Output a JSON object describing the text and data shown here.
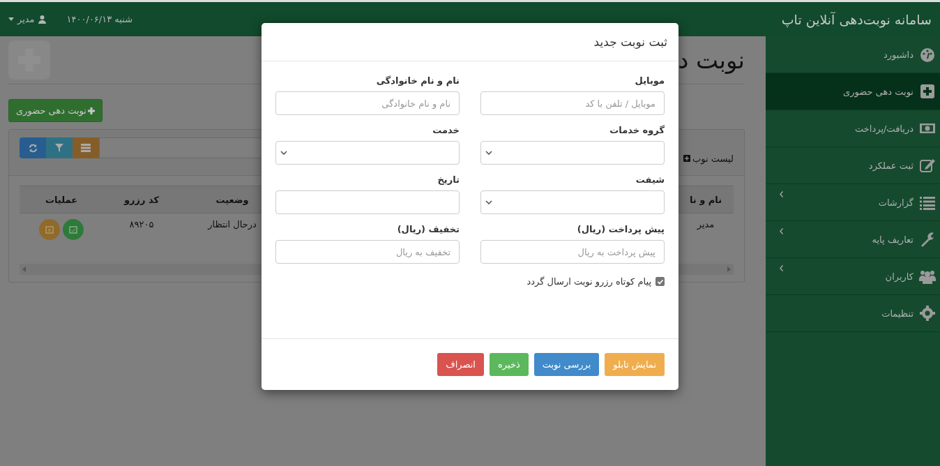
{
  "topbar": {
    "user": "مدیر",
    "date": "شنبه ۱۴۰۰/۰۶/۱۳"
  },
  "page": {
    "heading": "نوبت د",
    "add_button": "نوبت دهی حضوری"
  },
  "list_panel": {
    "title": "لیست نوب",
    "columns": [
      "نام و نا",
      "وضعیت",
      "کد رزرو",
      "عملیات"
    ],
    "rows": [
      {
        "code": "۸۹۲۰۵",
        "status": "درحال انتظار",
        "name": "مدیر"
      }
    ]
  },
  "sidebar": {
    "brand": "سامانه نوبت‌دهی آنلاین تاپ",
    "items": [
      {
        "label": "داشبورد",
        "selected": false,
        "expandable": false
      },
      {
        "label": "نوبت دهی حضوری",
        "selected": true,
        "expandable": false
      },
      {
        "label": "دریافت/پرداخت",
        "selected": false,
        "expandable": false
      },
      {
        "label": "ثبت عملکرد",
        "selected": false,
        "expandable": false
      },
      {
        "label": "گزارشات",
        "selected": false,
        "expandable": true
      },
      {
        "label": "تعاریف پایه",
        "selected": false,
        "expandable": true
      },
      {
        "label": "کاربران",
        "selected": false,
        "expandable": true
      },
      {
        "label": "تنظیمات",
        "selected": false,
        "expandable": false
      }
    ]
  },
  "modal": {
    "title": "ثبت نوبت جدید",
    "fields": [
      {
        "label": "موبایل",
        "kind": "text",
        "placeholder": "موبایل / تلفن با کد"
      },
      {
        "label": "نام و نام خانوادگی",
        "kind": "text",
        "placeholder": "نام و نام خانوادگی"
      },
      {
        "label": "گروه خدمات",
        "kind": "select"
      },
      {
        "label": "خدمت",
        "kind": "select"
      },
      {
        "label": "شیفت",
        "kind": "select"
      },
      {
        "label": "تاریخ",
        "kind": "text"
      },
      {
        "label": "پیش پرداخت (ریال)",
        "kind": "text",
        "placeholder": "پیش پرداخت به ریال"
      },
      {
        "label": "تخفیف (ریال)",
        "kind": "text",
        "placeholder": "تخفیف به ریال"
      }
    ],
    "sms_checkbox": {
      "label": "پیام کوتاه رزرو نوبت ارسال گردد",
      "checked": true
    },
    "buttons": [
      {
        "label": "نمایش تابلو",
        "kind": "warning"
      },
      {
        "label": "بررسی نوبت",
        "kind": "primary"
      },
      {
        "label": "ذخیره",
        "kind": "success"
      },
      {
        "label": "انصراف",
        "kind": "danger"
      }
    ]
  }
}
